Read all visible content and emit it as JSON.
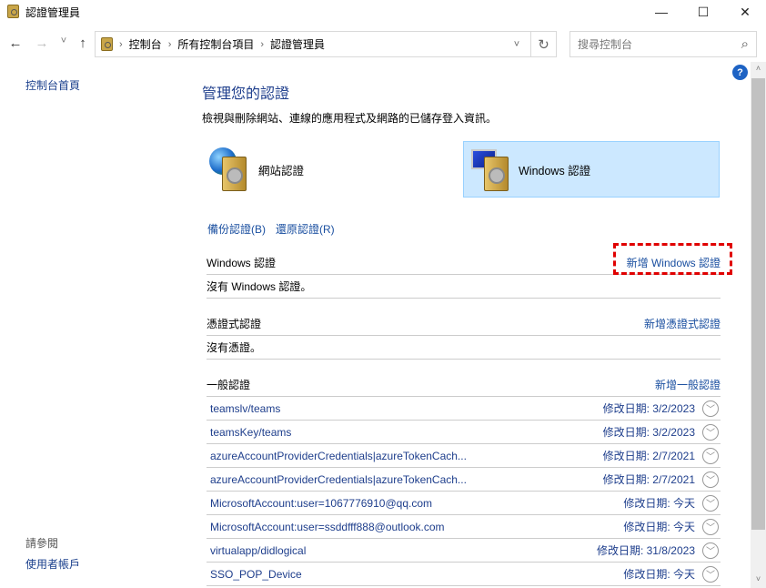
{
  "window": {
    "title": "認證管理員",
    "minimize": "—",
    "maximize": "☐",
    "close": "✕"
  },
  "nav": {
    "back": "←",
    "forward": "→",
    "recent": "˅",
    "up": "↑",
    "breadcrumb": [
      "控制台",
      "所有控制台項目",
      "認證管理員"
    ],
    "dropdown": "˅",
    "refresh": "↻",
    "search_placeholder": "搜尋控制台",
    "search_icon": "⌕"
  },
  "sidebar": {
    "home": "控制台首頁",
    "see_also": "請參閱",
    "user_accounts": "使用者帳戶"
  },
  "main": {
    "title": "管理您的認證",
    "description": "檢視與刪除網站、連線的應用程式及網路的已儲存登入資訊。",
    "tiles": [
      {
        "label": "網站認證",
        "selected": false
      },
      {
        "label": "Windows 認證",
        "selected": true
      }
    ],
    "backup": "備份認證(B)",
    "restore": "還原認證(R)",
    "windows_section": {
      "title": "Windows 認證",
      "add": "新增 Windows 認證",
      "empty": "沒有 Windows 認證。"
    },
    "cert_section": {
      "title": "憑證式認證",
      "add": "新增憑證式認證",
      "empty": "沒有憑證。"
    },
    "generic_section": {
      "title": "一般認證",
      "add": "新增一般認證",
      "items": [
        {
          "name": "teamslv/teams",
          "date": "修改日期:  3/2/2023"
        },
        {
          "name": "teamsKey/teams",
          "date": "修改日期:  3/2/2023"
        },
        {
          "name": "azureAccountProviderCredentials|azureTokenCach...",
          "date": "修改日期:  2/7/2021"
        },
        {
          "name": "azureAccountProviderCredentials|azureTokenCach...",
          "date": "修改日期:  2/7/2021"
        },
        {
          "name": "MicrosoftAccount:user=1067776910@qq.com",
          "date": "修改日期:  今天"
        },
        {
          "name": "MicrosoftAccount:user=ssddfff888@outlook.com",
          "date": "修改日期:  今天"
        },
        {
          "name": "virtualapp/didlogical",
          "date": "修改日期:  31/8/2023"
        },
        {
          "name": "SSO_POP_Device",
          "date": "修改日期:  今天"
        }
      ]
    }
  },
  "help": "?"
}
